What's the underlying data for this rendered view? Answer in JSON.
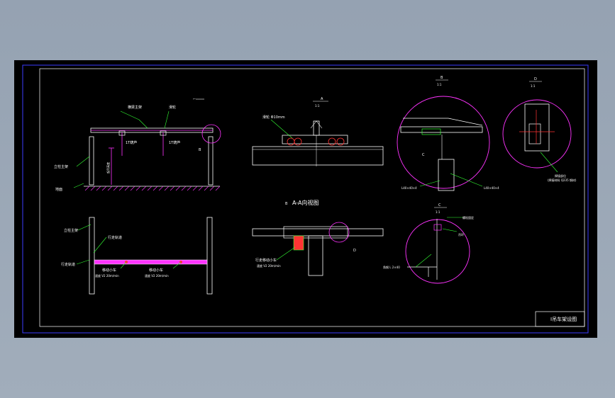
{
  "drawing": {
    "title_block": "I吊车架设图",
    "section_marks": {
      "top_mark": "⌐",
      "aa": {
        "letter": "A",
        "scale": "1:1"
      },
      "b": {
        "letter": "B",
        "scale": "1:1"
      },
      "d": {
        "letter": "D",
        "scale": "1:1"
      },
      "c": {
        "letter": "C",
        "scale": "1:1"
      }
    },
    "view_title": "A-A向视图",
    "view_prefix": "B",
    "letters": {
      "b_small": "B",
      "c_small": "C",
      "d_small": "D"
    },
    "front_view": {
      "labels": {
        "upper_left": "横梁主架",
        "upper_right": "滑轮",
        "hoist_left": "1T葫芦",
        "hoist_right": "1T葫芦",
        "column": "立柱主架",
        "floor": "地面",
        "height_dim": "起吊高度"
      }
    },
    "plan_view": {
      "labels": {
        "col": "立柱主架",
        "rail_l": "行走轨道",
        "rail_l2": "行走轨道",
        "trolley_l": "移动小车",
        "trolley_l_spec": "速度 V2 20m/min",
        "trolley_r": "移动小车",
        "trolley_r_spec": "速度 V2 20m/min"
      }
    },
    "aa_view": {
      "labels": {
        "wheel": "滑轮 Φ10mm"
      }
    },
    "plan_detail": {
      "labels": {
        "trolley": "行走移动小车",
        "trolley_spec": "速度 V2 20m/min"
      }
    },
    "detail_b": {
      "labels": {
        "angle_a": "L40×40×4",
        "angle_b": "L40×40×4"
      }
    },
    "detail_d": {
      "labels": {
        "note1": "焊接部位",
        "note2": "(焊接材料 Q235 钢材)"
      }
    },
    "detail_c": {
      "labels": {
        "bolt": "螺栓固定",
        "ring": "吊环",
        "angle": "角钢 L 2×40"
      }
    }
  }
}
